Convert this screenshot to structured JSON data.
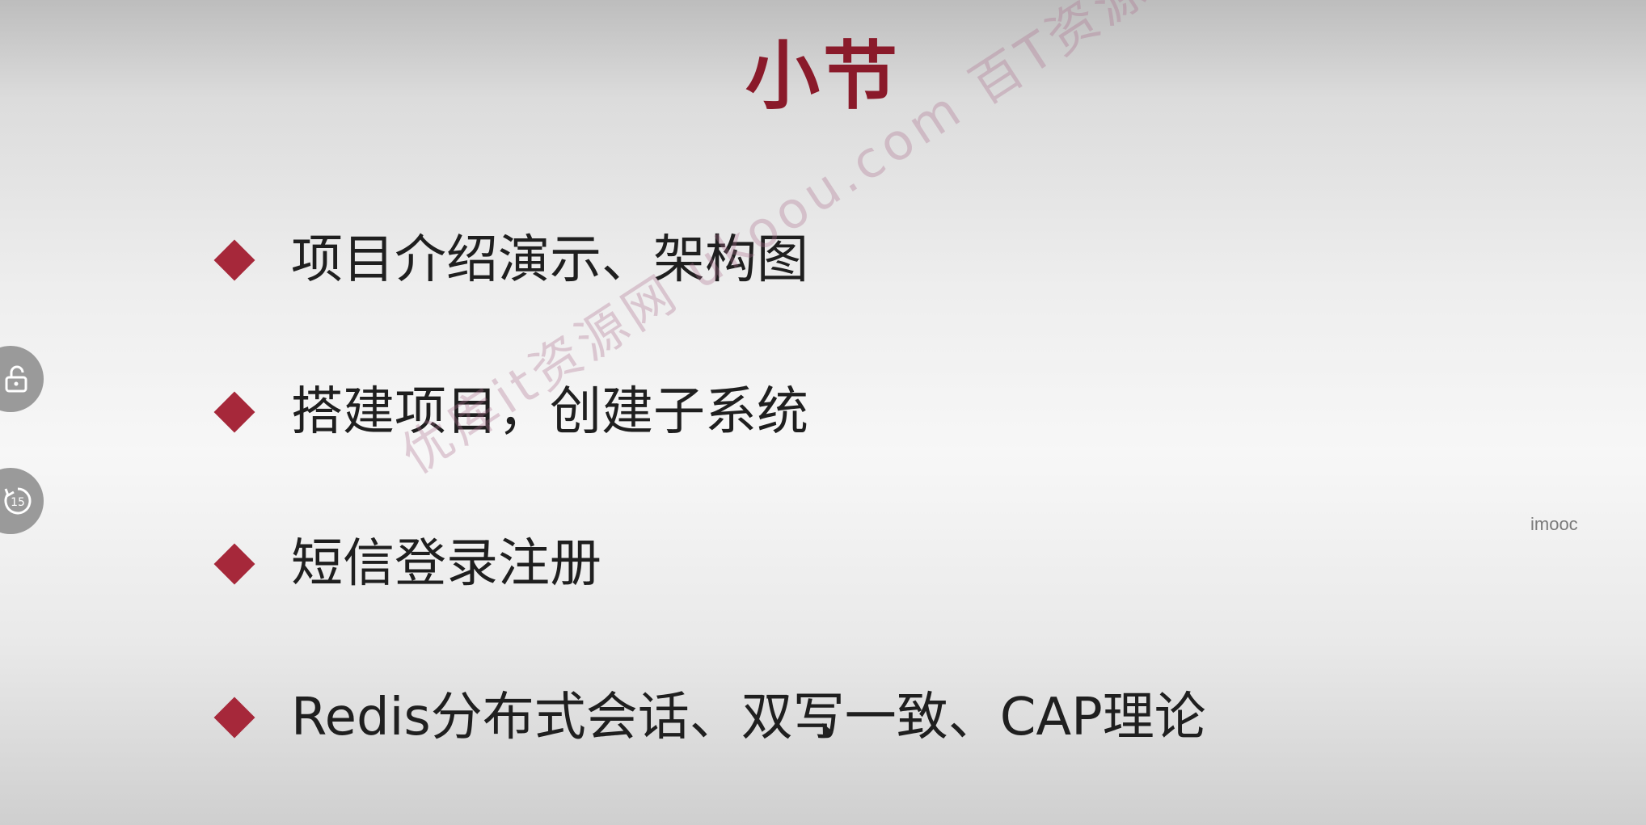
{
  "slide": {
    "title": "小节",
    "bullets": [
      "项目介绍演示、架构图",
      "搭建项目，创建子系统",
      "短信登录注册",
      "Redis分布式会话、双写一致、CAP理论"
    ],
    "brand_tag": "imooc",
    "watermark": "优库it资源网 ukoou.com 百T资源随心下"
  },
  "player": {
    "lock_icon": "unlock-icon",
    "replay_icon": "replay-15-icon",
    "replay_label": "15"
  },
  "colors": {
    "title": "#8a1a2a",
    "bullet_marker": "#a6283a",
    "text": "#1f1f1f"
  }
}
